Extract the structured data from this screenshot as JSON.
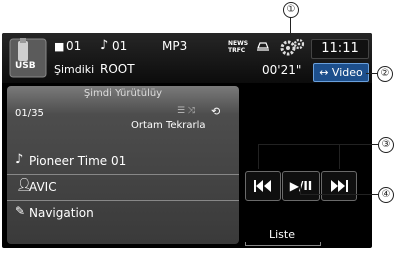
{
  "source": {
    "label": "USB"
  },
  "header": {
    "folder_num": "01",
    "track_num": "01",
    "format": "MP3",
    "mode": "Şimdiki",
    "folder_name": "ROOT",
    "news_label": "NEWS",
    "trfc_label": "TRFC",
    "time_elapsed": "00'21\"",
    "clock": "11:11",
    "video_button": "↔ Video"
  },
  "now_playing": {
    "title": "Şimdi Yürütülüy",
    "track_count": "01/35",
    "repeat_mode": "Ortam Tekrarla",
    "song": "Pioneer Time 01",
    "artist": "AVIC",
    "album": "Navigation"
  },
  "controls": {
    "prev": "⏮",
    "play_pause": "▶/II",
    "next": "⏭",
    "list": "Liste"
  },
  "callouts": [
    "①",
    "②",
    "③",
    "④"
  ]
}
